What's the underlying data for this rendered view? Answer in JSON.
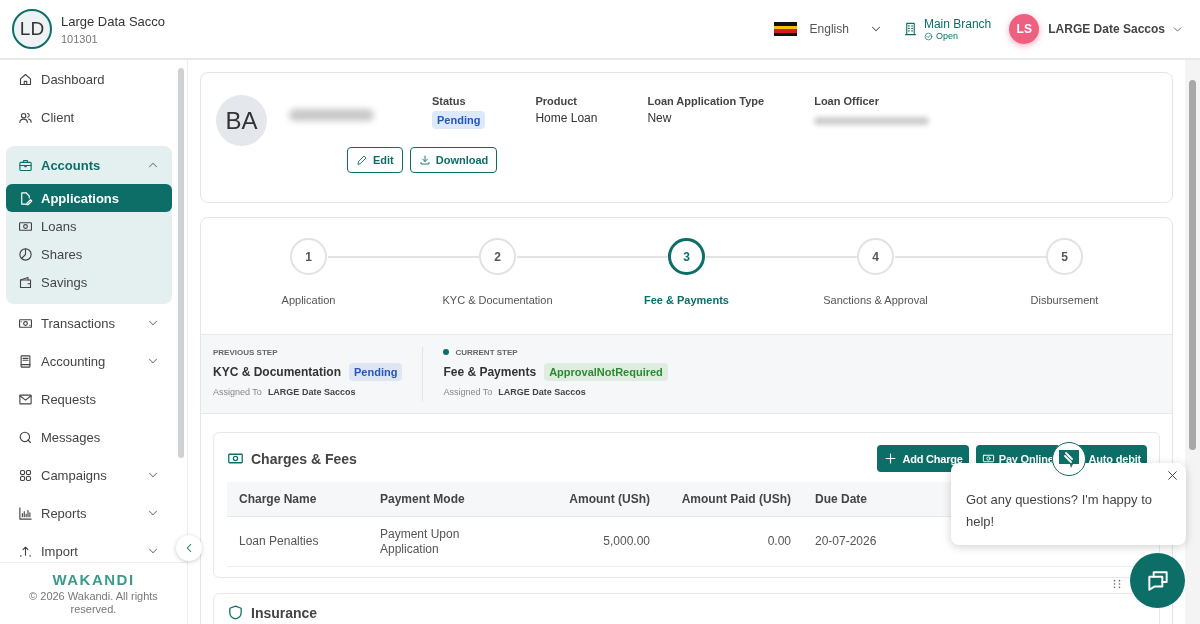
{
  "header": {
    "org_initials": "LD",
    "org_name": "Large Data Sacco",
    "org_code": "101301",
    "language": "English",
    "branch": {
      "name": "Main Branch",
      "status": "Open"
    },
    "user": {
      "initials": "LS",
      "name": "LARGE Date Saccos"
    }
  },
  "sidebar": {
    "items": [
      {
        "label": "Dashboard",
        "selected": false
      },
      {
        "label": "Client",
        "selected": false
      },
      {
        "label": "Accounts",
        "selected": false,
        "expanded": true,
        "children": [
          {
            "label": "Applications",
            "selected": true
          },
          {
            "label": "Loans",
            "selected": false
          },
          {
            "label": "Shares",
            "selected": false
          },
          {
            "label": "Savings",
            "selected": false
          }
        ]
      },
      {
        "label": "Transactions",
        "selected": false,
        "expanded": false
      },
      {
        "label": "Accounting",
        "selected": false,
        "expanded": false
      },
      {
        "label": "Requests",
        "selected": false
      },
      {
        "label": "Messages",
        "selected": false
      },
      {
        "label": "Campaigns",
        "selected": false,
        "expanded": false
      },
      {
        "label": "Reports",
        "selected": false,
        "expanded": false
      },
      {
        "label": "Import",
        "selected": false,
        "expanded": false
      }
    ],
    "footer": {
      "logo": "WAKANDI",
      "copyright": "© 2026 Wakandi. All rights reserved."
    }
  },
  "profile": {
    "initials": "BA",
    "fields": [
      {
        "label": "Status",
        "value": "Pending",
        "kind": "badge"
      },
      {
        "label": "Product",
        "value": "Home Loan",
        "kind": "text"
      },
      {
        "label": "Loan Application Type",
        "value": "New",
        "kind": "text"
      },
      {
        "label": "Loan Officer",
        "kind": "redacted"
      }
    ],
    "buttons": [
      "Edit",
      "Download"
    ]
  },
  "steps": [
    {
      "number": "1",
      "label": "Application",
      "selected": false
    },
    {
      "number": "2",
      "label": "KYC & Documentation",
      "selected": false
    },
    {
      "number": "3",
      "label": "Fee & Payments",
      "selected": true
    },
    {
      "number": "4",
      "label": "Sanctions & Approval",
      "selected": false
    },
    {
      "number": "5",
      "label": "Disbursement",
      "selected": false
    }
  ],
  "step_info": [
    {
      "heading": "PREVIOUS STEP",
      "name": "KYC & Documentation",
      "status": "Pending",
      "color": "#2456b8",
      "assigned_label": "Assigned To",
      "assignee": "LARGE Date Saccos",
      "current": false
    },
    {
      "heading": "CURRENT STEP",
      "name": "Fee & Payments",
      "status": "ApprovalNotRequired",
      "color": "#2a8a2f",
      "assigned_label": "Assigned To",
      "assignee": "LARGE Date Saccos",
      "current": true
    }
  ],
  "charges": {
    "title": "Charges & Fees",
    "actions": [
      "Add Charge",
      "Pay Online",
      "Auto debit"
    ],
    "columns": [
      "Charge Name",
      "Payment Mode",
      "Amount (USh)",
      "Amount Paid (USh)",
      "Due Date"
    ],
    "rows": [
      {
        "cells": [
          "Loan Penalties",
          "Payment Upon Application",
          "5,000.00",
          "0.00",
          "20-07-2026"
        ]
      }
    ]
  },
  "insurance": {
    "title": "Insurance"
  },
  "chat": {
    "message": "Got any questions? I'm happy to help!"
  }
}
